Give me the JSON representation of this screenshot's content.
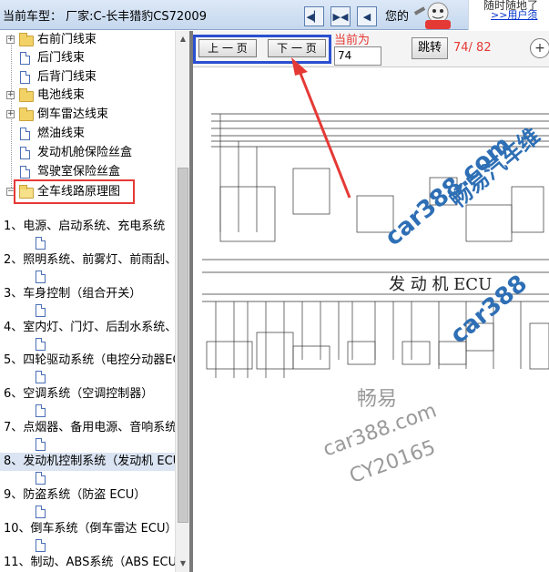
{
  "topbar": {
    "title": "当前车型： 厂家:C-长丰猎豹CS72009",
    "nav_icons": [
      "first-page-icon",
      "fit-icon",
      "next-icon"
    ],
    "user_text": "您的",
    "ad_line1": "随时随地了",
    "ad_link": ">>用户须"
  },
  "tree": {
    "items": [
      {
        "type": "folder",
        "label": "右前门线束",
        "expandable": true
      },
      {
        "type": "doc",
        "label": "后门线束"
      },
      {
        "type": "doc",
        "label": "后背门线束"
      },
      {
        "type": "folder",
        "label": "电池线束",
        "expandable": true
      },
      {
        "type": "folder",
        "label": "倒车雷达线束",
        "expandable": true
      },
      {
        "type": "doc",
        "label": "燃油线束"
      },
      {
        "type": "doc",
        "label": "发动机舱保险丝盒"
      },
      {
        "type": "doc",
        "label": "驾驶室保险丝盒"
      },
      {
        "type": "folder-open",
        "label": "全车线路原理图",
        "expandable": true,
        "highlighted_box": true
      }
    ],
    "sections": [
      {
        "label": "1、电源、启动系统、充电系统"
      },
      {
        "label": "2、照明系统、前雾灯、前雨刮、"
      },
      {
        "label": "3、车身控制（组合开关）"
      },
      {
        "label": "4、室内灯、门灯、后刮水系统、"
      },
      {
        "label": "5、四轮驱动系统（电控分动器EC"
      },
      {
        "label": "6、空调系统（空调控制器）"
      },
      {
        "label": "7、点烟器、备用电源、音响系统"
      },
      {
        "label": "8、发动机控制系统（发动机 ECU",
        "selected": true
      },
      {
        "label": "9、防盗系统（防盗 ECU）"
      },
      {
        "label": "10、倒车系统（倒车雷达 ECU）"
      },
      {
        "label": "11、制动、ABS系统（ABS ECU"
      }
    ]
  },
  "viewer": {
    "prev_label": "上 一 页",
    "next_label": "下 一 页",
    "current_label": "当前为",
    "page_value": "74",
    "go_label": "跳转",
    "page_count": "74/ 82",
    "zoom_icon": "zoom-in-icon"
  },
  "diagram": {
    "ecu_label": "发 动 机 ECU",
    "watermarks": [
      "畅易汽车维",
      "car388.com",
      "car388",
      "畅易",
      "car388.com",
      "CY20165"
    ]
  },
  "colors": {
    "annotation_red": "#e53935",
    "annotation_blue": "#2a4fd1",
    "selected_row": "#dbe4f2",
    "watermark_blue": "#2e6fb5",
    "watermark_gray": "#9a9a9a"
  }
}
